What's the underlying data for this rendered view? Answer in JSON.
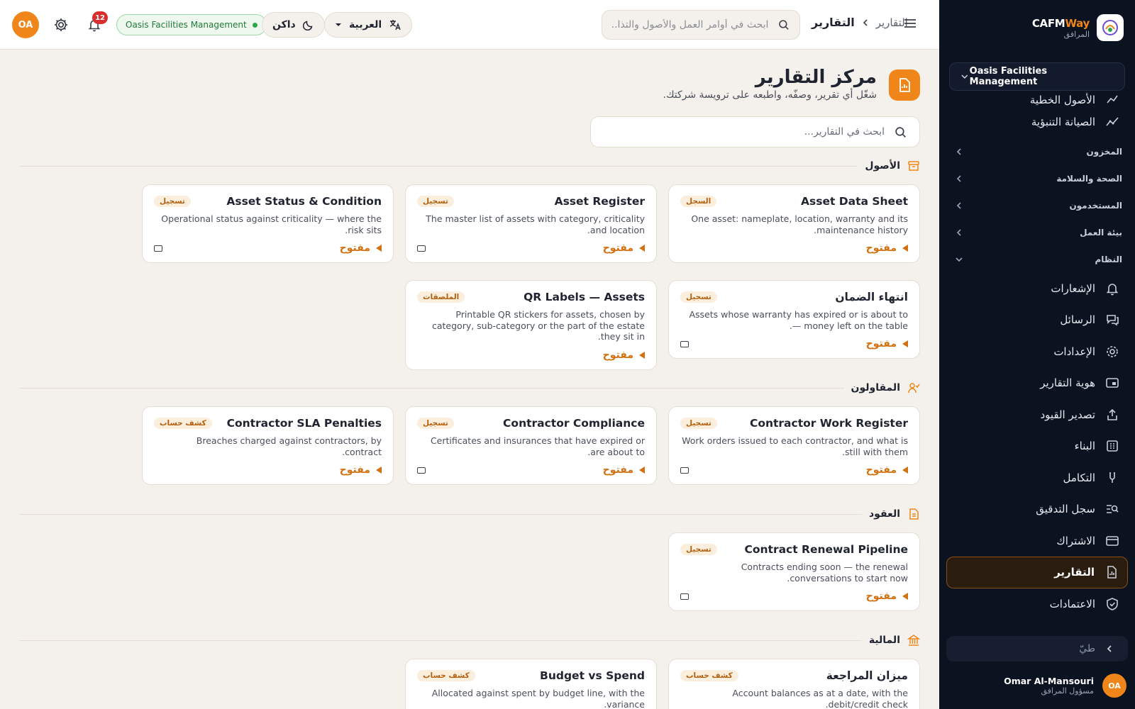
{
  "topbar": {
    "avatar_initials": "OA",
    "notifications_count": "12",
    "org_pill": "Oasis Facilities Management",
    "theme_label": "داكن",
    "language_label": "العربية",
    "search_placeholder": "ابحث في أوامر العمل والأصول والتذا...",
    "breadcrumb_parent": "التقارير",
    "breadcrumb_current": "التقارير"
  },
  "sidebar": {
    "brand_cafm": "CAFM",
    "brand_way": "Way",
    "brand_sub": "المرافق",
    "org_select": "Oasis Facilities Management",
    "partial_item": "الأصول الخطية",
    "items_top": [
      {
        "label": "الصيانة التنبؤية",
        "icon": "trend-icon"
      }
    ],
    "sections": [
      {
        "label": "المخزون"
      },
      {
        "label": "الصحة والسلامة"
      },
      {
        "label": "المستخدمون"
      },
      {
        "label": "بيئة العمل"
      },
      {
        "label": "النظام"
      }
    ],
    "items": [
      {
        "label": "الإشعارات",
        "icon": "bell-icon"
      },
      {
        "label": "الرسائل",
        "icon": "messages-icon"
      },
      {
        "label": "الإعدادات",
        "icon": "gear-icon"
      },
      {
        "label": "هوية التقارير",
        "icon": "brand-card-icon"
      },
      {
        "label": "تصدير القيود",
        "icon": "export-icon"
      },
      {
        "label": "البناء",
        "icon": "builder-icon"
      },
      {
        "label": "التكامل",
        "icon": "integration-icon"
      },
      {
        "label": "سجل التدقيق",
        "icon": "audit-icon"
      },
      {
        "label": "الاشتراك",
        "icon": "card-icon"
      },
      {
        "label": "التقارير",
        "icon": "reports-icon"
      },
      {
        "label": "الاعتمادات",
        "icon": "shield-check-icon"
      }
    ],
    "collapse_label": "طيّ",
    "user_initials": "OA",
    "user_name": "Omar Al-Mansouri",
    "user_role": "مسؤول المرافق"
  },
  "main": {
    "title": "مركز التقارير",
    "subtitle": "شغّل أي تقرير، وصفّه، واطبعه على ترويسة شركتك.",
    "search_placeholder": "ابحث في التقارير...",
    "open_label": "مفتوح",
    "sections": [
      {
        "title": "الأصول",
        "cards": [
          {
            "title": "Asset Data Sheet",
            "tag": "السجل",
            "desc": "One asset: nameplate, location, warranty and its maintenance history.",
            "checkbox": false
          },
          {
            "title": "Asset Register",
            "tag": "تسجيل",
            "desc": "The master list of assets with category, criticality and location.",
            "checkbox": true
          },
          {
            "title": "Asset Status & Condition",
            "tag": "تسجيل",
            "desc": "Operational status against criticality — where the risk sits.",
            "checkbox": true
          },
          {
            "title": "انتهاء الضمان",
            "tag": "تسجيل",
            "desc": "Assets whose warranty has expired or is about to — money left on the table.",
            "checkbox": true
          },
          {
            "title": "QR Labels — Assets",
            "tag": "الملصقات",
            "desc": "Printable QR stickers for assets, chosen by category, sub-category or the part of the estate they sit in.",
            "checkbox": false
          }
        ]
      },
      {
        "title": "المقاولون",
        "cards": [
          {
            "title": "Contractor Work Register",
            "tag": "تسجيل",
            "desc": "Work orders issued to each contractor, and what is still with them.",
            "checkbox": true
          },
          {
            "title": "Contractor Compliance",
            "tag": "تسجيل",
            "desc": "Certificates and insurances that have expired or are about to.",
            "checkbox": true
          },
          {
            "title": "Contractor SLA Penalties",
            "tag": "كشف حساب",
            "desc": "Breaches charged against contractors, by contract.",
            "checkbox": false
          }
        ]
      },
      {
        "title": "العقود",
        "cards": [
          {
            "title": "Contract Renewal Pipeline",
            "tag": "تسجيل",
            "desc": "Contracts ending soon — the renewal conversations to start now.",
            "checkbox": true
          }
        ]
      },
      {
        "title": "المالية",
        "cards": [
          {
            "title": "ميزان المراجعة",
            "tag": "كشف حساب",
            "desc": "Account balances as at a date, with the debit/credit check.",
            "checkbox": false
          },
          {
            "title": "Budget vs Spend",
            "tag": "كشف حساب",
            "desc": "Allocated against spent by budget line, with the variance.",
            "checkbox": false
          }
        ]
      }
    ]
  },
  "colors": {
    "accent": "#f0861a",
    "sidebar_bg": "#0b1220",
    "page_bg": "#f4f1ec",
    "badge": "#d92e2e",
    "online": "#2fa64a"
  }
}
